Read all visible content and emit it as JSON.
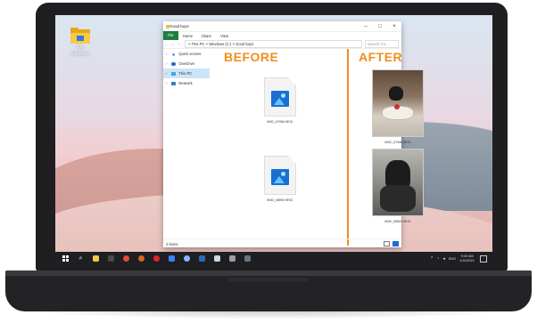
{
  "desktop": {
    "icon_label": "File\nExplorer"
  },
  "window": {
    "title": "Good boys",
    "ribbon_tabs": [
      "File",
      "Home",
      "Share",
      "View"
    ],
    "address": "> This PC > Windows (C:) > Good boys",
    "search_placeholder": "Search Go...",
    "nav_items": [
      {
        "label": "Quick access",
        "icon": "star-icon",
        "active": false
      },
      {
        "label": "OneDrive",
        "icon": "cloud-icon",
        "active": false
      },
      {
        "label": "This PC",
        "icon": "computer-icon",
        "active": true
      },
      {
        "label": "Network",
        "icon": "network-icon",
        "active": false
      }
    ],
    "status": "2 items"
  },
  "comparison": {
    "before_label": "BEFORE",
    "after_label": "AFTER",
    "before_files": [
      "IMG_0768.HEIC",
      "IMG_0850.HEIC"
    ],
    "after_files": [
      "IMG_0768.HEIC",
      "IMG_0850.HEIC"
    ]
  },
  "taskbar": {
    "time": "9:00 AM",
    "date": "1/16/2021",
    "tray_text": "ENG"
  },
  "colors": {
    "accent": "#f28c1c",
    "file_tab": "#1c7e3e",
    "selection": "#cce4f7"
  }
}
